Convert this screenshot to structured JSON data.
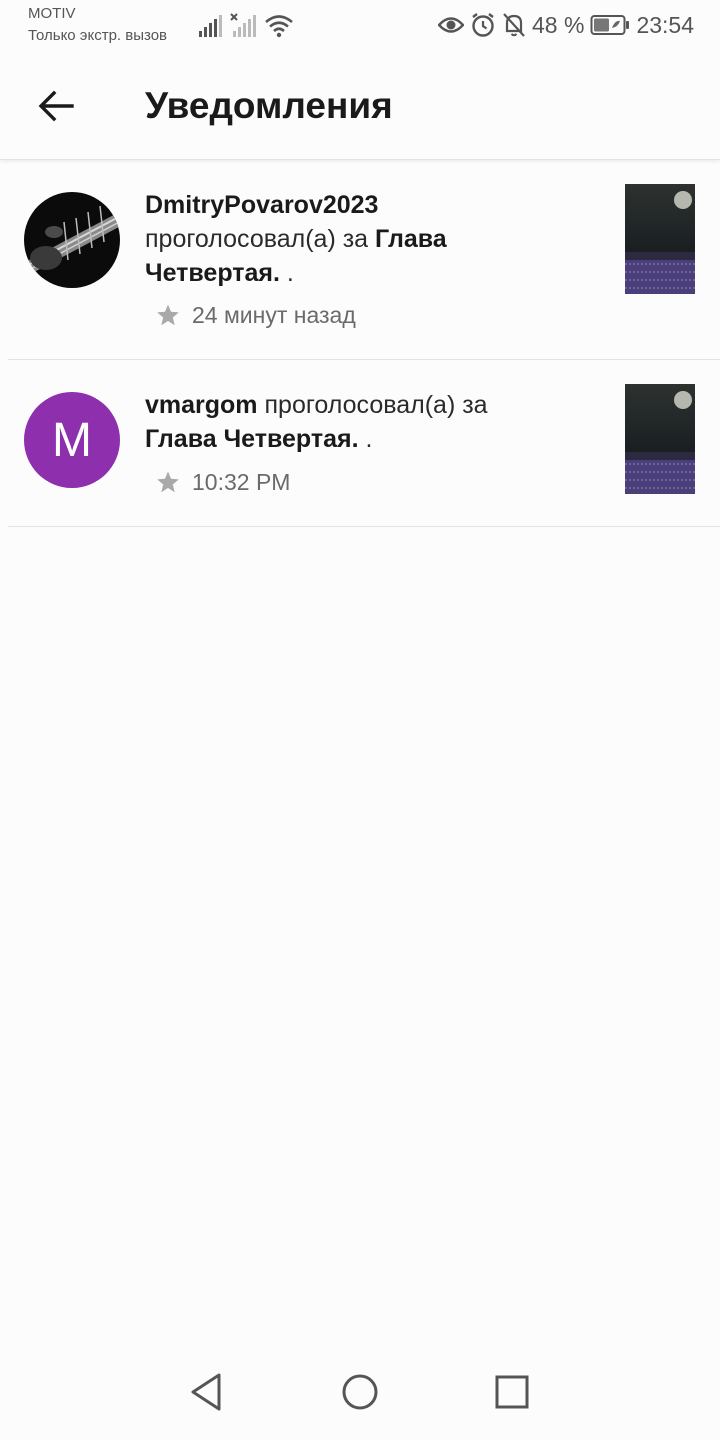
{
  "status_bar": {
    "carrier": "MOTIV",
    "carrier_status": "Только экстр. вызов",
    "battery": "48 %",
    "time": "23:54",
    "icons": [
      "signal-icon",
      "signal-no-sim-icon",
      "wifi-icon",
      "eye-icon",
      "alarm-icon",
      "notifications-off-icon",
      "battery-icon"
    ]
  },
  "header": {
    "back_icon": "arrow-back-icon",
    "title": "Уведомления"
  },
  "notifications": [
    {
      "user": "DmitryPovarov2023",
      "action": "проголосовал(а) за",
      "target": "Глава Четвертая.",
      "suffix": ".",
      "time": "24 минут назад",
      "avatar": "photo-guitar",
      "icon": "star-icon"
    },
    {
      "user": "vmargom",
      "action": "проголосовал(а) за",
      "target": "Глава Четвертая.",
      "suffix": ".",
      "time": "10:32 PM",
      "avatar_letter": "M",
      "avatar_color": "#8e2fad",
      "icon": "star-icon"
    }
  ],
  "nav_bar": {
    "icons": [
      "back-triangle-icon",
      "home-circle-icon",
      "recents-square-icon"
    ]
  }
}
